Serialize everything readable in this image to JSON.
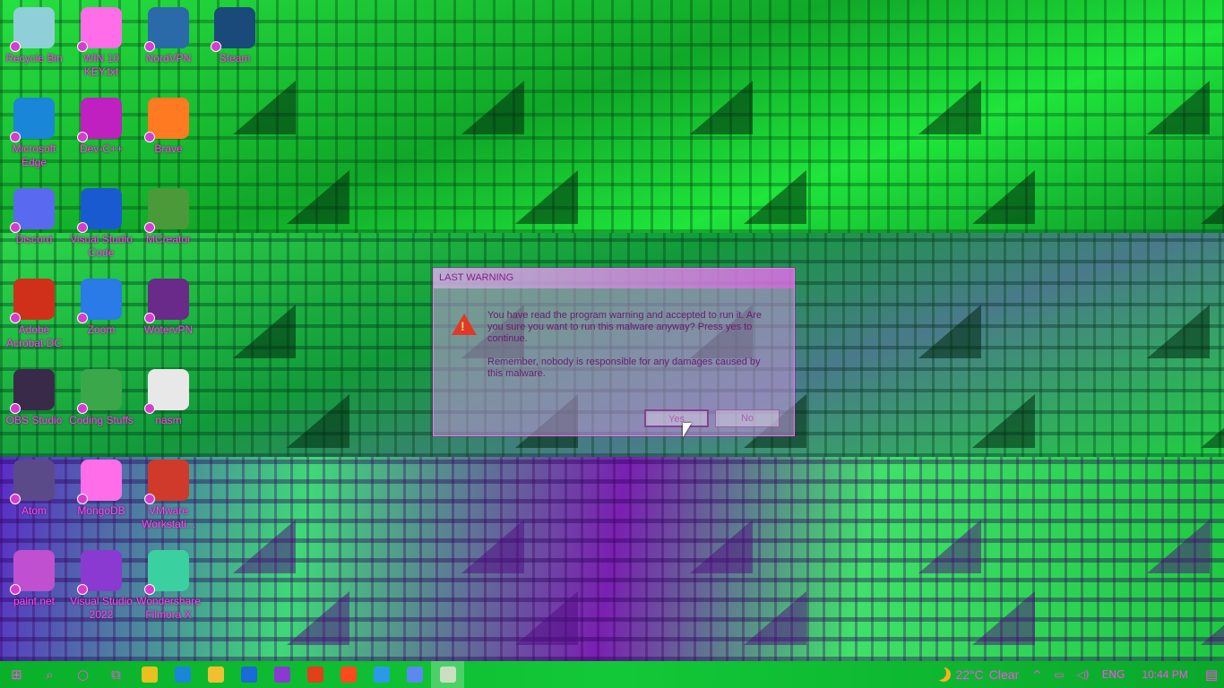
{
  "desktop": {
    "icons": [
      {
        "label": "Recycle Bin",
        "icon": "recycle-bin-icon",
        "color": "#8fd0d8"
      },
      {
        "label": "WIN 10 KEY.txt",
        "icon": "text-file-icon",
        "color": "#ff6ee8"
      },
      {
        "label": "NordVPN",
        "icon": "nordvpn-icon",
        "color": "#2a6aa8"
      },
      {
        "label": "Steam",
        "icon": "steam-icon",
        "color": "#1a4a7a"
      },
      {
        "label": "Microsoft Edge",
        "icon": "edge-icon",
        "color": "#1a86d8"
      },
      {
        "label": "Dev-C++",
        "icon": "dev-cpp-icon",
        "color": "#c020c0"
      },
      {
        "label": "Brave",
        "icon": "brave-icon",
        "color": "#ff7a20"
      },
      {
        "label": "Discord",
        "icon": "discord-icon",
        "color": "#5a6af0"
      },
      {
        "label": "Visual Studio Code",
        "icon": "vscode-icon",
        "color": "#1a5ad0"
      },
      {
        "label": "MCreator",
        "icon": "mcreator-icon",
        "color": "#4a9a3a"
      },
      {
        "label": "Adobe Acrobat DC",
        "icon": "acrobat-icon",
        "color": "#d0301a"
      },
      {
        "label": "Zoom",
        "icon": "zoom-icon",
        "color": "#2a7ae8"
      },
      {
        "label": "WotervPN",
        "icon": "vpn-icon",
        "color": "#6a2a8a"
      },
      {
        "label": "OBS Studio",
        "icon": "obs-icon",
        "color": "#3a2a4a"
      },
      {
        "label": "Coding Stuffs",
        "icon": "folder-icon",
        "color": "#3aa84a"
      },
      {
        "label": "nasm",
        "icon": "nasm-icon",
        "color": "#e8e8e8"
      },
      {
        "label": "Atom",
        "icon": "atom-icon",
        "color": "#5a4a8a"
      },
      {
        "label": "MongoDB",
        "icon": "mongodb-icon",
        "color": "#ff6ee8"
      },
      {
        "label": "VMware Workstati...",
        "icon": "vmware-icon",
        "color": "#d03a2a"
      },
      {
        "label": "paint.net",
        "icon": "paint-net-icon",
        "color": "#c050d0"
      },
      {
        "label": "Visual Studio 2022",
        "icon": "visual-studio-icon",
        "color": "#8a3ad0"
      },
      {
        "label": "Wondershare Filmora X",
        "icon": "filmora-icon",
        "color": "#3ad0a0"
      }
    ]
  },
  "dialog": {
    "title": "LAST WARNING",
    "message": "You have read the program warning and accepted to run it. Are you sure you want to run this malware anyway? Press yes to continue.",
    "message2": "Remember, nobody is responsible for any damages caused by this malware.",
    "yes_label": "Yes",
    "no_label": "No"
  },
  "taskbar": {
    "apps": [
      {
        "icon": "file-manager-icon",
        "color": "#e8c020"
      },
      {
        "icon": "edge-icon",
        "color": "#1a86d8"
      },
      {
        "icon": "folder-icon",
        "color": "#f0c030"
      },
      {
        "icon": "vscode-icon",
        "color": "#1a6ad8"
      },
      {
        "icon": "visual-studio-icon",
        "color": "#8a3ad0"
      },
      {
        "icon": "office-icon",
        "color": "#e0401a"
      },
      {
        "icon": "brave-icon",
        "color": "#ff4a20"
      },
      {
        "icon": "zoom-icon",
        "color": "#2a9ae8"
      },
      {
        "icon": "discord-icon",
        "color": "#5a8af0"
      },
      {
        "icon": "dialog-window-icon",
        "color": "#c8e0c0"
      }
    ],
    "weather": {
      "temp": "22°C",
      "condition": "Clear"
    },
    "language": "ENG",
    "time": "10:44 PM"
  }
}
